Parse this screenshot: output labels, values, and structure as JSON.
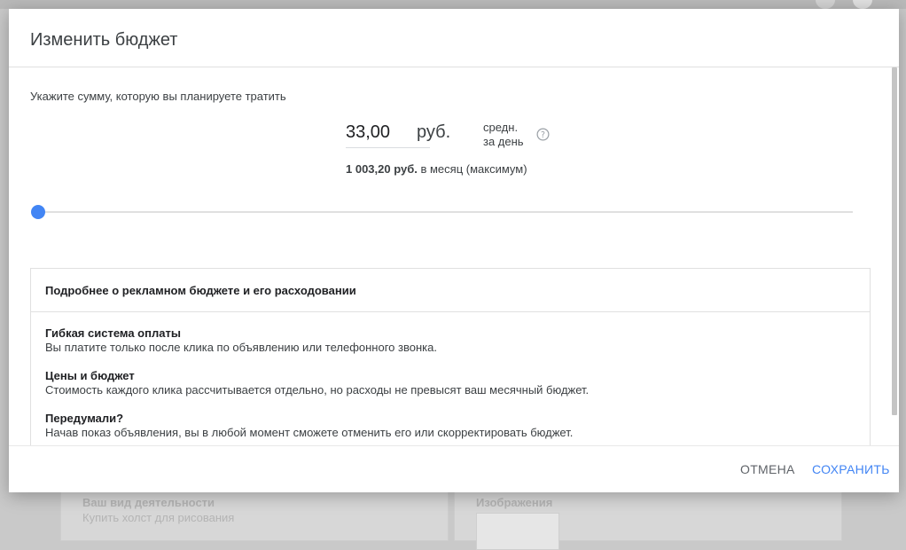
{
  "dialog": {
    "title": "Изменить бюджет",
    "prompt": "Укажите сумму, которую вы планируете тратить",
    "amount_value": "33,00",
    "currency": "руб.",
    "period_line1": "средн.",
    "period_line2": "за день",
    "help_icon": "question-circle-icon",
    "monthly_amount": "1 003,20 руб.",
    "monthly_suffix": " в месяц (максимум)",
    "slider_position_fraction": 0.0,
    "accent_color": "#4285f4",
    "info": {
      "title": "Подробнее о рекламном бюджете и его расходовании",
      "items": [
        {
          "heading": "Гибкая система оплаты",
          "text": "Вы платите только после клика по объявлению или телефонного звонка."
        },
        {
          "heading": "Цены и бюджет",
          "text": "Стоимость каждого клика рассчитывается отдельно, но расходы не превысят ваш месячный бюджет."
        },
        {
          "heading": "Передумали?",
          "text": "Начав показ объявления, вы в любой момент сможете отменить его или скорректировать бюджет."
        }
      ]
    },
    "buttons": {
      "cancel": "ОТМЕНА",
      "save": "СОХРАНИТЬ"
    }
  },
  "background": {
    "card_left": {
      "title": "Ваш вид деятельности",
      "subtitle": "Купить холст для рисования"
    },
    "card_right": {
      "title": "Изображения"
    }
  }
}
